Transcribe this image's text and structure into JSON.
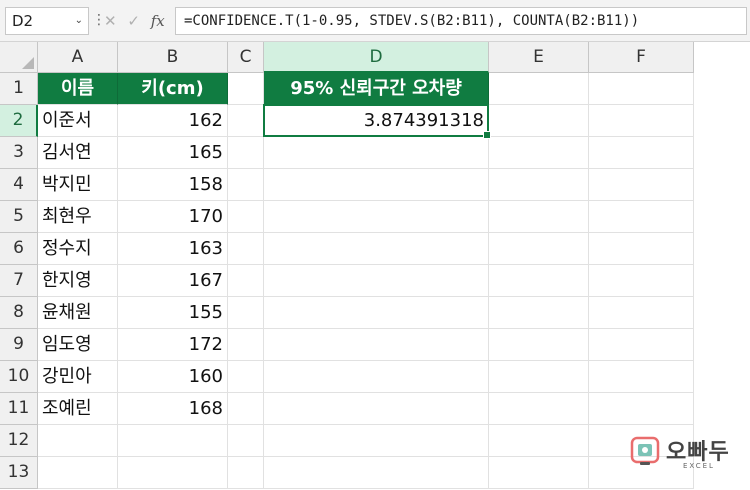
{
  "formula_bar": {
    "name_box": "D2",
    "cancel_icon": "✕",
    "enter_icon": "✓",
    "fx_label": "fx",
    "formula": "=CONFIDENCE.T(1-0.95, STDEV.S(B2:B11), COUNTA(B2:B11))"
  },
  "columns": [
    "A",
    "B",
    "C",
    "D",
    "E",
    "F"
  ],
  "rows": [
    "1",
    "2",
    "3",
    "4",
    "5",
    "6",
    "7",
    "8",
    "9",
    "10",
    "11",
    "12",
    "13"
  ],
  "table": {
    "header_name": "이름",
    "header_height": "키(cm)",
    "records": [
      {
        "name": "이준서",
        "height": "162"
      },
      {
        "name": "김서연",
        "height": "165"
      },
      {
        "name": "박지민",
        "height": "158"
      },
      {
        "name": "최현우",
        "height": "170"
      },
      {
        "name": "정수지",
        "height": "163"
      },
      {
        "name": "한지영",
        "height": "167"
      },
      {
        "name": "윤채원",
        "height": "155"
      },
      {
        "name": "임도영",
        "height": "172"
      },
      {
        "name": "강민아",
        "height": "160"
      },
      {
        "name": "조예린",
        "height": "168"
      }
    ]
  },
  "result": {
    "header": "95% 신뢰구간 오차량",
    "value": "3.874391318"
  },
  "selection": {
    "cell": "D2",
    "column": "D",
    "row": "2"
  },
  "logo": {
    "text_kr": "오빠두",
    "text_en": "EXCEL"
  },
  "colors": {
    "header_bg": "#107c41",
    "selection": "#107c41"
  }
}
